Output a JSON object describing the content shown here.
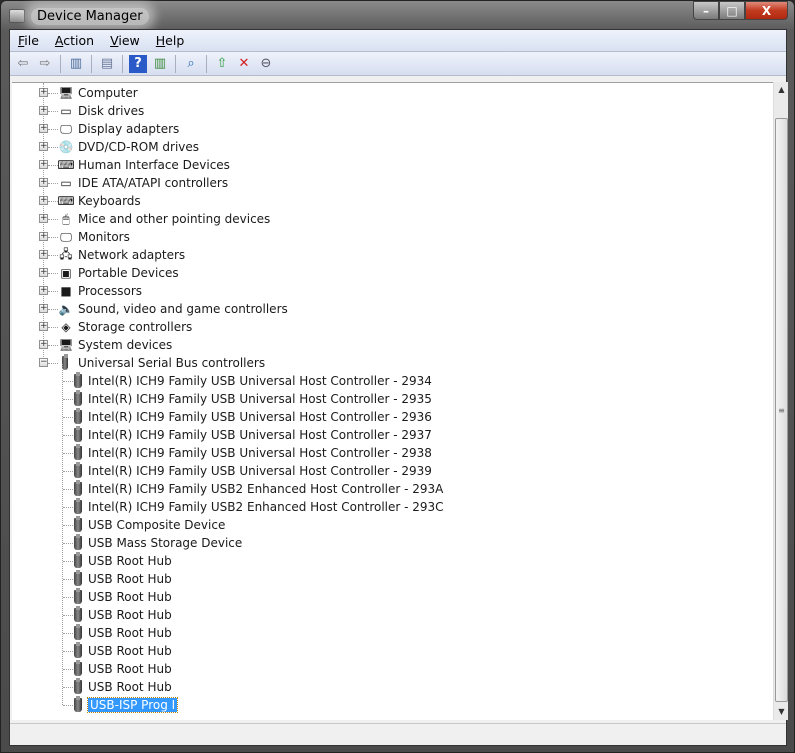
{
  "window": {
    "title": "Device Manager",
    "minimize": "–",
    "maximize": "□",
    "close": "X"
  },
  "menu": [
    {
      "label": "File",
      "key": "F",
      "rest": "ile"
    },
    {
      "label": "Action",
      "key": "A",
      "rest": "ction"
    },
    {
      "label": "View",
      "key": "V",
      "rest": "iew"
    },
    {
      "label": "Help",
      "key": "H",
      "rest": "elp"
    }
  ],
  "toolbar": [
    "back-icon",
    "forward-icon",
    "show-hide-console-tree-icon",
    "properties-icon",
    "help-icon",
    "show-hide-action-pane-icon",
    "scan-hardware-icon",
    "update-driver-icon",
    "uninstall-icon",
    "disable-icon"
  ],
  "tree": {
    "categories": [
      "Computer",
      "Disk drives",
      "Display adapters",
      "DVD/CD-ROM drives",
      "Human Interface Devices",
      "IDE ATA/ATAPI controllers",
      "Keyboards",
      "Mice and other pointing devices",
      "Monitors",
      "Network adapters",
      "Portable Devices",
      "Processors",
      "Sound, video and game controllers",
      "Storage controllers",
      "System devices",
      "Universal Serial Bus controllers"
    ],
    "usb_children": [
      "Intel(R) ICH9 Family USB Universal Host Controller - 2934",
      "Intel(R) ICH9 Family USB Universal Host Controller - 2935",
      "Intel(R) ICH9 Family USB Universal Host Controller - 2936",
      "Intel(R) ICH9 Family USB Universal Host Controller - 2937",
      "Intel(R) ICH9 Family USB Universal Host Controller - 2938",
      "Intel(R) ICH9 Family USB Universal Host Controller - 2939",
      "Intel(R) ICH9 Family USB2 Enhanced Host Controller - 293A",
      "Intel(R) ICH9 Family USB2 Enhanced Host Controller - 293C",
      "USB Composite Device",
      "USB Mass Storage Device",
      "USB Root Hub",
      "USB Root Hub",
      "USB Root Hub",
      "USB Root Hub",
      "USB Root Hub",
      "USB Root Hub",
      "USB Root Hub",
      "USB Root Hub",
      "USB-ISP Prog I"
    ],
    "selected": "USB-ISP Prog I"
  },
  "colors": {
    "selection": "#3399ff"
  }
}
